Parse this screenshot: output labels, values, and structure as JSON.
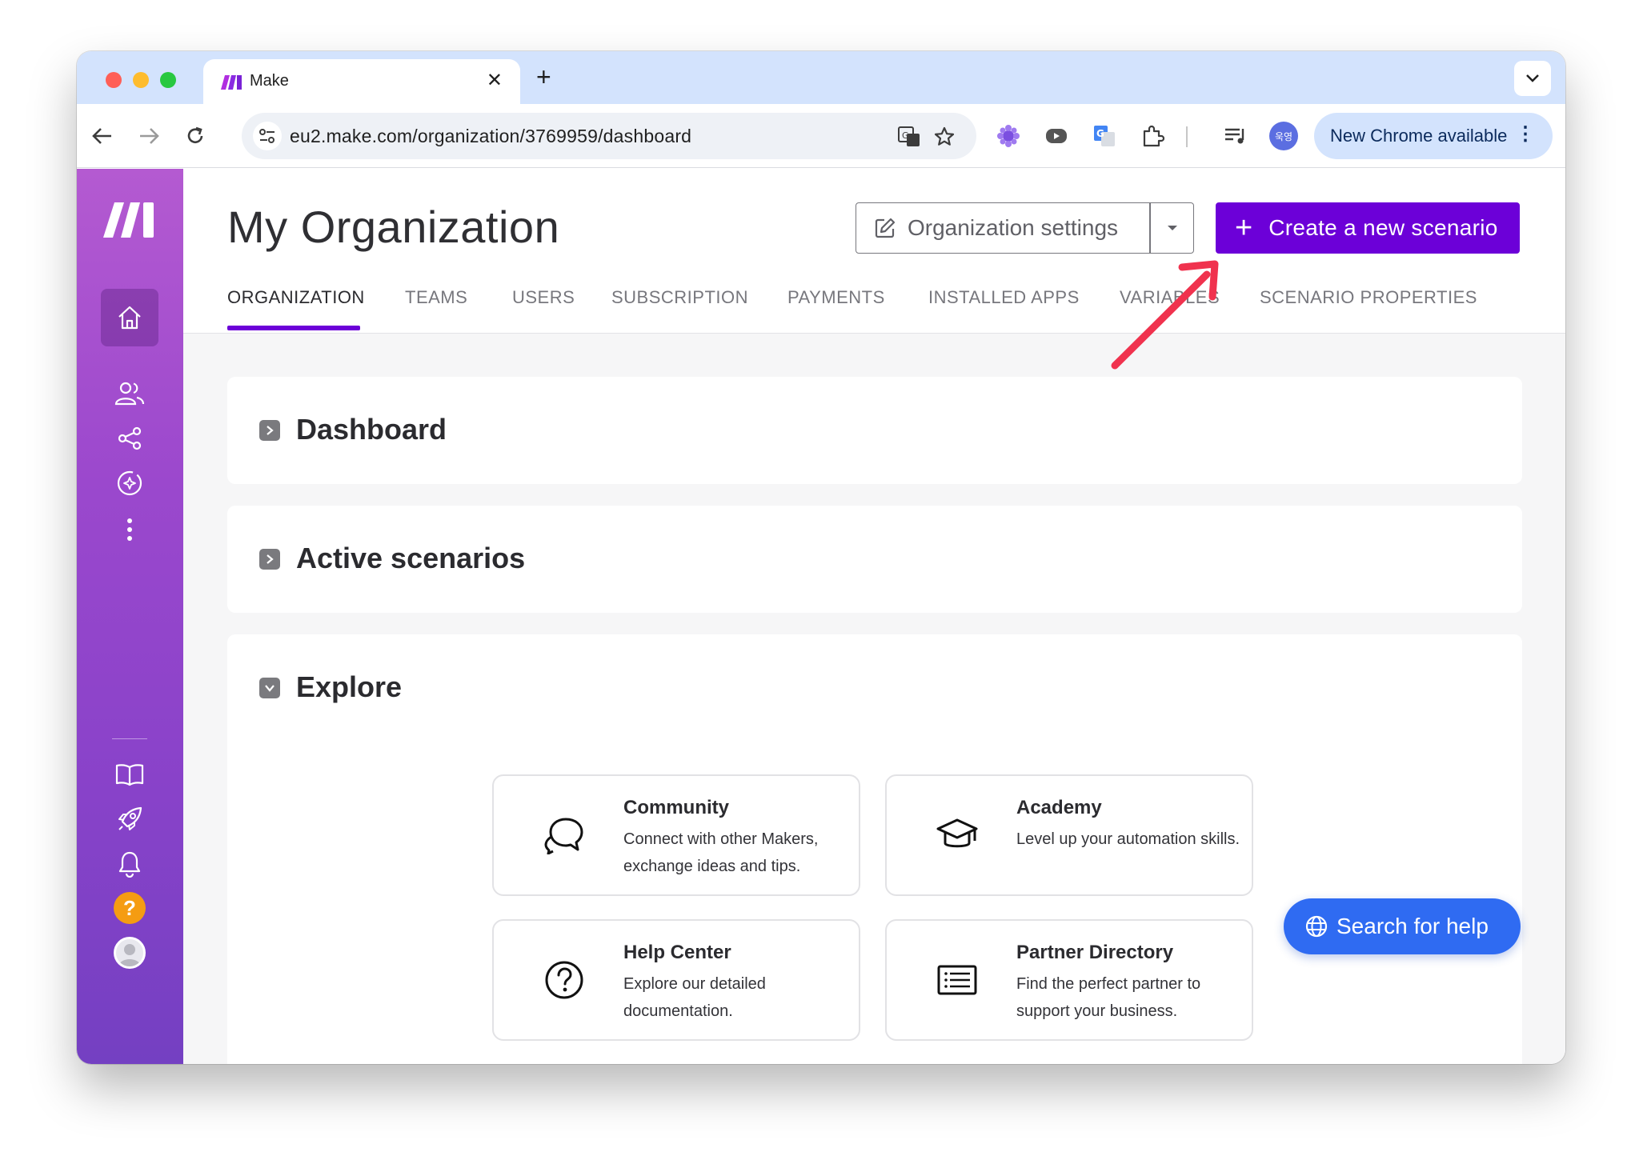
{
  "browser": {
    "tab_title": "Make",
    "url": "eu2.make.com/organization/3769959/dashboard",
    "profile_initials": "욱영",
    "update_label": "New Chrome available"
  },
  "header": {
    "title": "My Organization",
    "org_settings_label": "Organization settings",
    "create_label": "Create a new scenario"
  },
  "tabs": [
    "ORGANIZATION",
    "TEAMS",
    "USERS",
    "SUBSCRIPTION",
    "PAYMENTS",
    "INSTALLED APPS",
    "VARIABLES",
    "SCENARIO PROPERTIES"
  ],
  "sections": {
    "dashboard": "Dashboard",
    "active_scenarios": "Active scenarios",
    "explore": "Explore"
  },
  "tiles": [
    {
      "title": "Community",
      "desc": "Connect with other Makers, exchange ideas and tips.",
      "icon": "chat-bubbles-icon"
    },
    {
      "title": "Academy",
      "desc": "Level up your automation skills.",
      "icon": "graduation-cap-icon"
    },
    {
      "title": "Help Center",
      "desc": "Explore our detailed documentation.",
      "icon": "question-circle-icon"
    },
    {
      "title": "Partner Directory",
      "desc": "Find the perfect partner to support your business.",
      "icon": "list-icon"
    }
  ],
  "search_help_label": "Search for help",
  "colors": {
    "brand_purple": "#6c00d8",
    "sidebar_top": "#b45ad1",
    "sidebar_bottom": "#7440c2",
    "search_blue": "#2f6bf2",
    "annotation_red": "#f0324e",
    "help_orange": "#f59c12"
  }
}
